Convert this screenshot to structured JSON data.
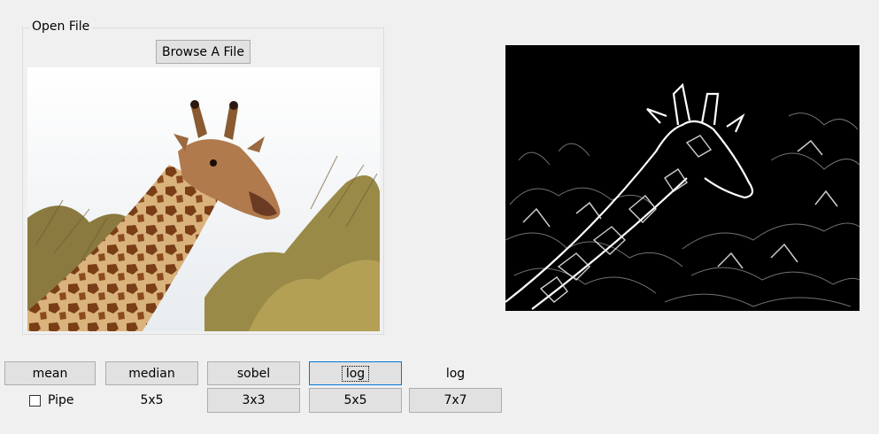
{
  "open_file": {
    "group_label": "Open File",
    "browse_label": "Browse A File"
  },
  "images": {
    "original_alt": "giraffe photo",
    "processed_alt": "edge-detected giraffe"
  },
  "filters": {
    "mean_label": "mean",
    "median_label": "median",
    "sobel_label": "sobel",
    "log_button_label": "log",
    "log_text_label": "log"
  },
  "options": {
    "pipe_label": "Pipe",
    "median_size_label": "5x5",
    "sobel_3x3_label": "3x3",
    "log_5x5_label": "5x5",
    "log_7x7_label": "7x7"
  }
}
